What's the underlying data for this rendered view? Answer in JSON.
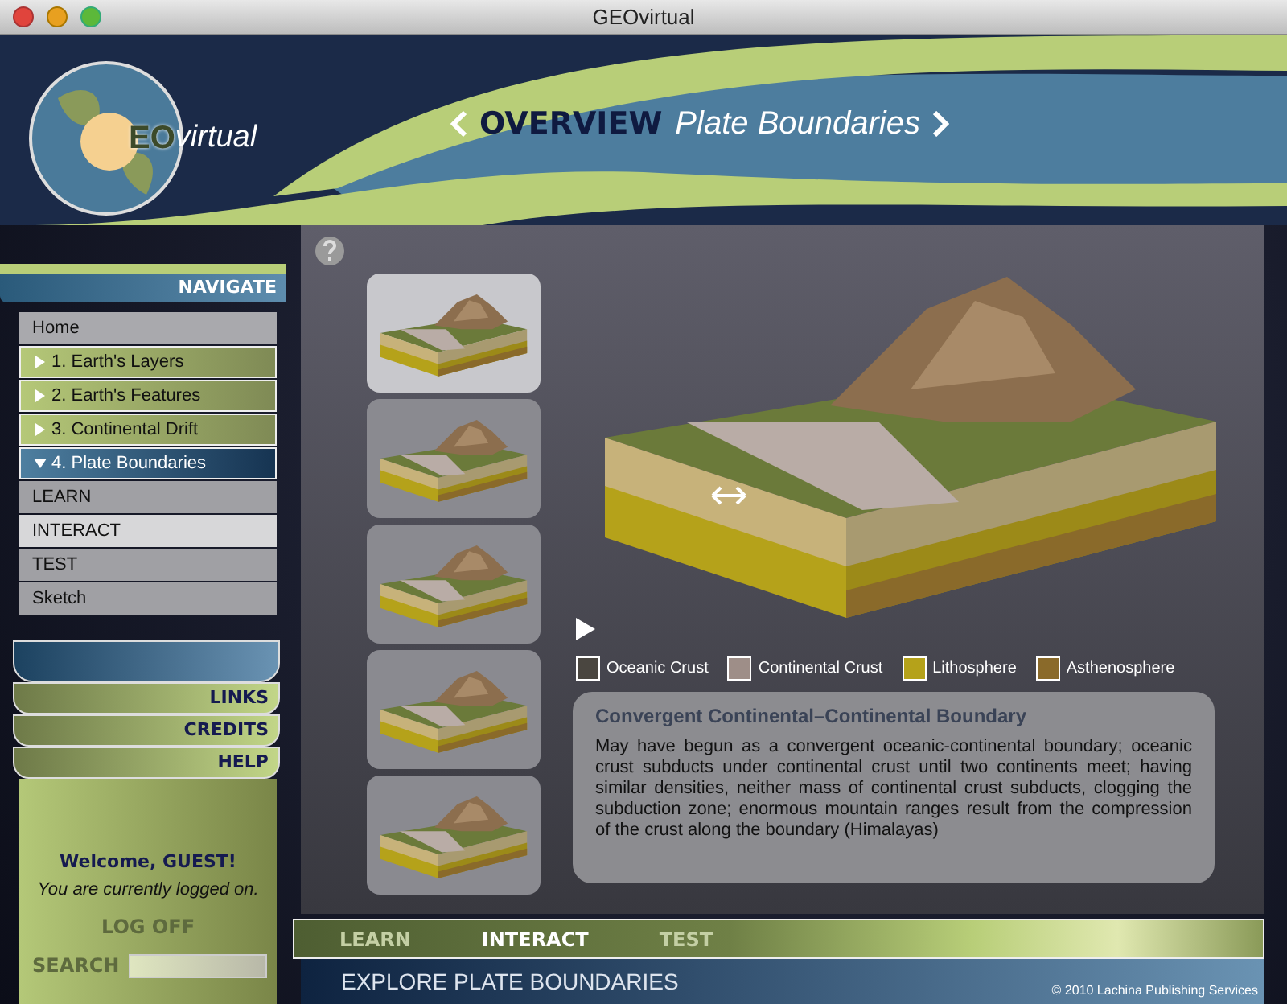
{
  "window": {
    "title": "GEOvirtual"
  },
  "logo": {
    "letters": "EO",
    "text": "virtual"
  },
  "header": {
    "section": "OVERVIEW",
    "topic": "Plate Boundaries"
  },
  "navigate_label": "NAVIGATE",
  "nav": [
    {
      "kind": "home",
      "label": "Home",
      "selected": false
    },
    {
      "kind": "chapter",
      "label": "1. Earth's Layers",
      "selected": false,
      "expanded": false
    },
    {
      "kind": "chapter",
      "label": "2. Earth's Features",
      "selected": false,
      "expanded": false
    },
    {
      "kind": "chapter",
      "label": "3. Continental Drift",
      "selected": false,
      "expanded": false
    },
    {
      "kind": "chapter",
      "label": "4. Plate Boundaries",
      "selected": true,
      "expanded": true
    },
    {
      "kind": "sub",
      "label": "LEARN",
      "selected": false
    },
    {
      "kind": "sub",
      "label": "INTERACT",
      "selected": true
    },
    {
      "kind": "sub",
      "label": "TEST",
      "selected": false
    },
    {
      "kind": "sub",
      "label": "Sketch",
      "selected": false
    }
  ],
  "links": [
    "LINKS",
    "CREDITS",
    "HELP"
  ],
  "account": {
    "welcome": "Welcome, GUEST!",
    "status": "You are currently logged on.",
    "logoff": "LOG OFF",
    "search_label": "SEARCH"
  },
  "thumbnails": [
    {
      "selected": true
    },
    {
      "selected": false
    },
    {
      "selected": false
    },
    {
      "selected": false
    },
    {
      "selected": false
    }
  ],
  "legend": [
    {
      "label": "Oceanic Crust",
      "color": "#4a4640"
    },
    {
      "label": "Continental Crust",
      "color": "#9e8e88"
    },
    {
      "label": "Lithosphere",
      "color": "#b5a21a"
    },
    {
      "label": "Asthenosphere",
      "color": "#8a6a2a"
    }
  ],
  "info": {
    "title": "Convergent Continental–Continental Boundary",
    "body": "May have begun as a convergent oceanic-continental  boundary; oceanic crust subducts under continental crust until two continents meet; having similar densities, neither mass of continental crust subducts, clogging the subduction zone; enormous mountain ranges result from the compression of the crust along the boundary (Himalayas)"
  },
  "bottom_tabs": [
    {
      "label": "LEARN",
      "selected": false
    },
    {
      "label": "INTERACT",
      "selected": true
    },
    {
      "label": "TEST",
      "selected": false
    }
  ],
  "footer": {
    "title": "EXPLORE PLATE BOUNDARIES",
    "copyright": "© 2010 Lachina Publishing Services"
  }
}
